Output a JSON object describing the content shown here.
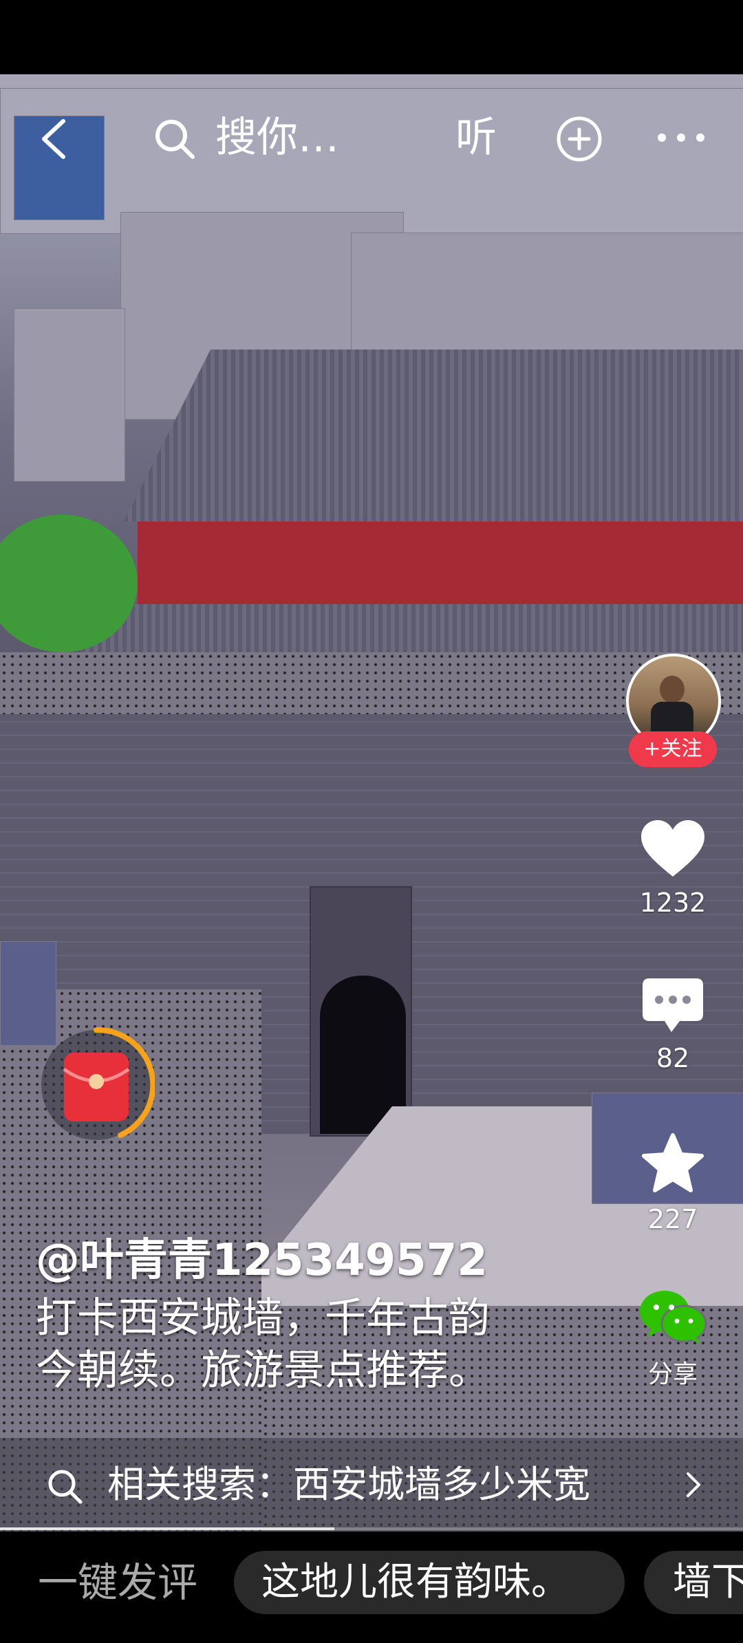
{
  "header": {
    "search_text": "搜你…",
    "listen_label": "听"
  },
  "author": {
    "handle": "@叶青青125349572",
    "follow_label": "+关注"
  },
  "actions": {
    "likes": "1232",
    "comments": "82",
    "favorites": "227",
    "share_label": "分享"
  },
  "description": {
    "line1": "打卡西安城墙，千年古韵",
    "line2": "今朝续。旅游景点推荐。"
  },
  "related": {
    "text": "相关搜索：西安城墙多少米宽"
  },
  "bottom": {
    "quick_label": "一键发评",
    "chips": [
      "这地儿很有韵味。",
      "墙下"
    ]
  },
  "playback": {
    "progress_fraction": 0.45
  },
  "colors": {
    "follow": "#f03a4c",
    "wechat": "#2dc100",
    "redpacket": "#e8303a"
  }
}
